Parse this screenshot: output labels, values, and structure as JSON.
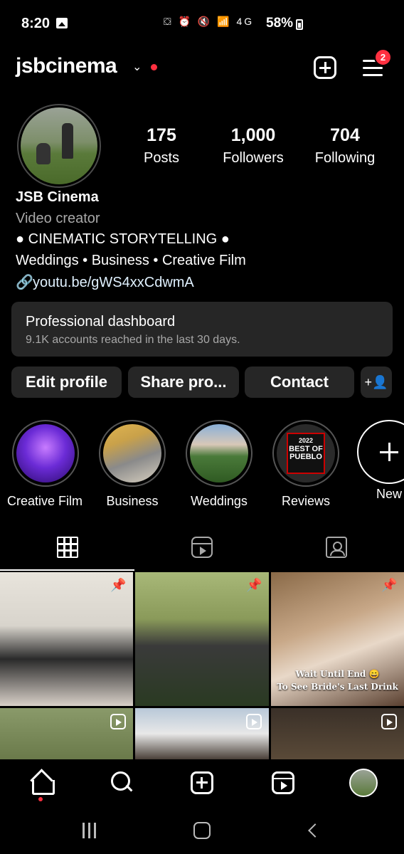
{
  "status_bar": {
    "time": "8:20",
    "system_icons": "⛋ ⏰ 🔇 📶 4G",
    "battery_pct": "58%"
  },
  "header": {
    "username": "jsbcinema",
    "notification_badge": "2"
  },
  "profile": {
    "stats": {
      "posts_count": "175",
      "posts_label": "Posts",
      "followers_count": "1,000",
      "followers_label": "Followers",
      "following_count": "704",
      "following_label": "Following"
    },
    "name": "JSB Cinema",
    "category": "Video creator",
    "bio_line1": "● CINEMATIC STORYTELLING ●",
    "bio_line2": "Weddings • Business • Creative Film",
    "link": "youtu.be/gWS4xxCdwmA"
  },
  "dashboard": {
    "title": "Professional dashboard",
    "subtitle": "9.1K accounts reached in the last 30 days."
  },
  "actions": {
    "edit_profile": "Edit profile",
    "share_profile": "Share pro...",
    "contact": "Contact"
  },
  "highlights": [
    {
      "label": "Creative Film"
    },
    {
      "label": "Business"
    },
    {
      "label": "Weddings"
    },
    {
      "label": "Reviews",
      "cover_text_top": "2022",
      "cover_text_main": "BEST OF PUEBLO"
    },
    {
      "label": "New"
    }
  ],
  "posts": {
    "caption_line1": "Wait Until End 😄",
    "caption_line2": "To See Bride's Last Drink"
  },
  "colors": {
    "background": "#000000",
    "surface": "#262626",
    "secondary_text": "#a8a8a8",
    "notification_red": "#ff3040",
    "link": "#e0f1ff"
  }
}
